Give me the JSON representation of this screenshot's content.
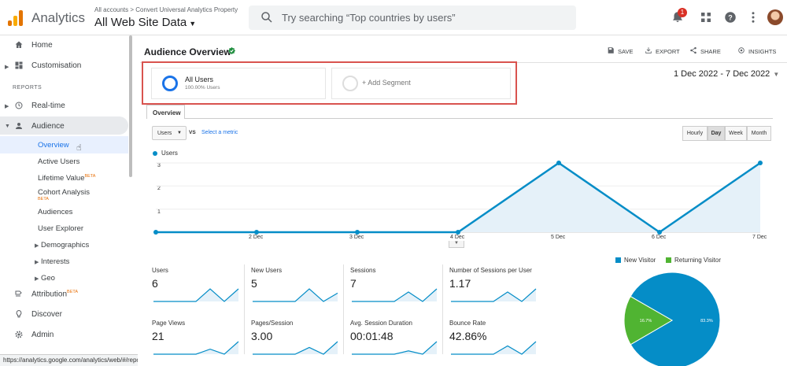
{
  "header": {
    "brand": "Analytics",
    "breadcrumb": "All accounts > Convert Universal Analytics Property",
    "property": "All Web Site Data",
    "search_placeholder": "Try searching “Top countries by users”",
    "notification_count": "1"
  },
  "sidebar": {
    "home": "Home",
    "customisation": "Customisation",
    "reports_label": "REPORTS",
    "realtime": "Real-time",
    "audience": "Audience",
    "overview": "Overview",
    "active_users": "Active Users",
    "lifetime_value": "Lifetime Value",
    "lifetime_beta": "BETA",
    "cohort_analysis": "Cohort Analysis",
    "cohort_beta": "BETA",
    "audiences": "Audiences",
    "user_explorer": "User Explorer",
    "demographics": "Demographics",
    "interests": "Interests",
    "geo": "Geo",
    "attribution": "Attribution",
    "attribution_beta": "BETA",
    "discover": "Discover",
    "admin": "Admin"
  },
  "status_url": "https://analytics.google.com/analytics/web/#/report/visitors-overview/a109856904w2664736...",
  "page": {
    "title": "Audience Overview",
    "actions": {
      "save": "SAVE",
      "export": "EXPORT",
      "share": "SHARE",
      "insights": "INSIGHTS"
    },
    "segment_all_users": "All Users",
    "segment_all_users_sub": "100.00% Users",
    "add_segment": "+ Add Segment",
    "date_range": "1 Dec 2022 - 7 Dec 2022",
    "tab_overview": "Overview",
    "metric_select": "Users",
    "vs": "VS",
    "select_metric": "Select a metric",
    "granularity": [
      "Hourly",
      "Day",
      "Week",
      "Month"
    ],
    "granularity_selected": "Day"
  },
  "chart_data": {
    "type": "area",
    "series": [
      {
        "name": "Users",
        "values": [
          0,
          0,
          0,
          0,
          3,
          0,
          3
        ]
      }
    ],
    "x_tick_labels": [
      "",
      "2 Dec",
      "3 Dec",
      "4 Dec",
      "5 Dec",
      "6 Dec",
      "7 Dec"
    ],
    "y_ticks": [
      "3",
      "2",
      "1"
    ],
    "ylim": [
      0,
      3
    ],
    "color": "#058dc7"
  },
  "metrics": [
    {
      "label": "Users",
      "value": "6",
      "spark": [
        0,
        0,
        0,
        0,
        3,
        0,
        3
      ]
    },
    {
      "label": "New Users",
      "value": "5",
      "spark": [
        0,
        0,
        0,
        0,
        3,
        0,
        2
      ]
    },
    {
      "label": "Sessions",
      "value": "7",
      "spark": [
        0,
        0,
        0,
        0,
        3,
        0,
        4
      ]
    },
    {
      "label": "Number of Sessions per User",
      "value": "1.17",
      "spark": [
        0,
        0,
        0,
        0,
        1,
        0,
        1.33
      ]
    },
    {
      "label": "Page Views",
      "value": "21",
      "spark": [
        0,
        0,
        0,
        0,
        6,
        0,
        15
      ]
    },
    {
      "label": "Pages/Session",
      "value": "3.00",
      "spark": [
        0,
        0,
        0,
        0,
        2,
        0,
        3.75
      ]
    },
    {
      "label": "Avg. Session Duration",
      "value": "00:01:48",
      "spark": [
        0,
        0,
        0,
        0,
        40,
        0,
        150
      ]
    },
    {
      "label": "Bounce Rate",
      "value": "42.86%",
      "spark": [
        0,
        0,
        0,
        0,
        33,
        0,
        50
      ]
    }
  ],
  "pie": {
    "legend": [
      {
        "label": "New Visitor",
        "color": "#058dc7"
      },
      {
        "label": "Returning Visitor",
        "color": "#50b432"
      }
    ],
    "values": [
      83.3,
      16.7
    ],
    "labels": [
      "83.3%",
      "16.7%"
    ]
  }
}
